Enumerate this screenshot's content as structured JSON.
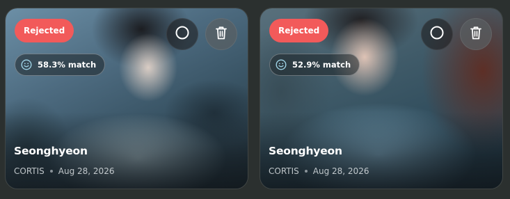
{
  "cards": [
    {
      "status": "Rejected",
      "match": "58.3% match",
      "name": "Seonghyeon",
      "group": "CORTIS",
      "date": "Aug 28, 2026"
    },
    {
      "status": "Rejected",
      "match": "52.9% match",
      "name": "Seonghyeon",
      "group": "CORTIS",
      "date": "Aug 28, 2026"
    }
  ],
  "icons": {
    "select": "circle-icon",
    "delete": "trash-icon",
    "match": "smile-icon"
  },
  "colors": {
    "background": "#2b302f",
    "rejected_badge": "#f25a5a",
    "text": "#ffffff"
  }
}
